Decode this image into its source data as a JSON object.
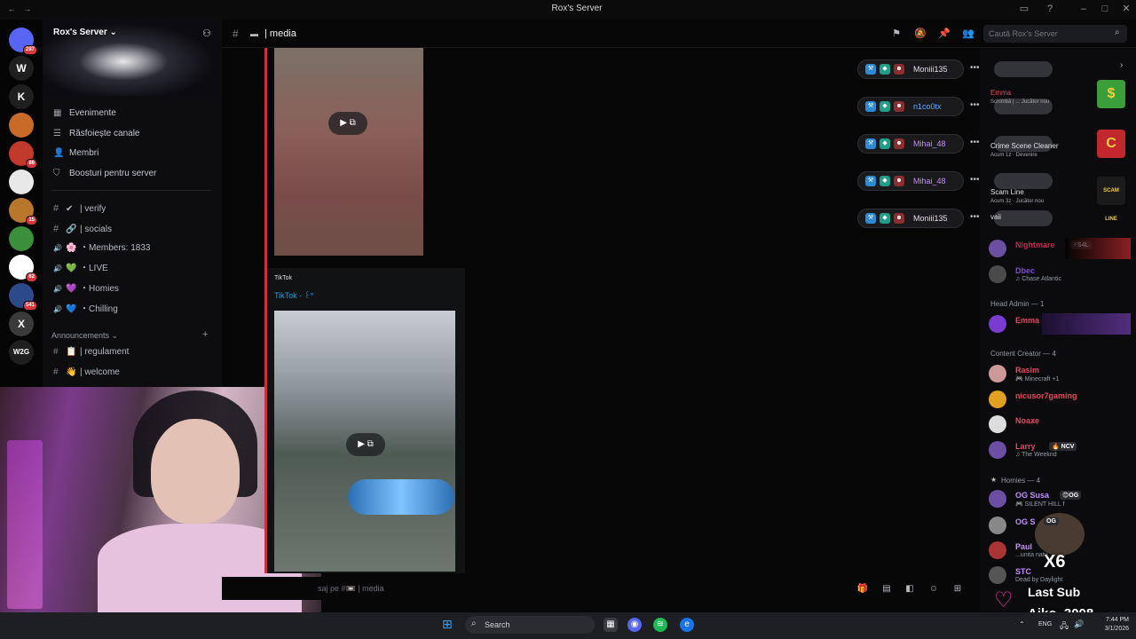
{
  "window": {
    "title": "Rox's Server"
  },
  "server": {
    "name": "Rox's Server",
    "nav": [
      {
        "label": "Evenimente",
        "icon": "calendar-icon"
      },
      {
        "label": "Răsfoiește canale",
        "icon": "browse-icon"
      },
      {
        "label": "Membri",
        "icon": "members-icon"
      },
      {
        "label": "Boosturi pentru server",
        "icon": "boost-icon"
      }
    ],
    "channels": [
      {
        "label": "| verify",
        "type": "text",
        "emoji": "✔"
      },
      {
        "label": "| socials",
        "type": "text",
        "emoji": "🔗"
      },
      {
        "label": "・Members: 1833",
        "type": "voice",
        "emoji": "🌸"
      },
      {
        "label": "・LIVE",
        "type": "voice",
        "emoji": "💚"
      },
      {
        "label": "・Homies",
        "type": "voice",
        "emoji": "💜"
      },
      {
        "label": "・Chilling",
        "type": "voice",
        "emoji": "💙"
      }
    ],
    "category": "Announcements",
    "announcement_channels": [
      {
        "label": "| regulament",
        "emoji": "📋"
      },
      {
        "label": "| welcome",
        "emoji": "👋"
      }
    ]
  },
  "server_rail": [
    {
      "letter": "",
      "badge": "287"
    },
    {
      "letter": "W",
      "badge": ""
    },
    {
      "letter": "K",
      "badge": ""
    },
    {
      "letter": "",
      "badge": ""
    },
    {
      "letter": "",
      "badge": "86"
    },
    {
      "letter": "",
      "badge": ""
    },
    {
      "letter": "",
      "badge": "15"
    },
    {
      "letter": "",
      "badge": ""
    },
    {
      "letter": "",
      "badge": "62"
    },
    {
      "letter": "",
      "badge": "541"
    },
    {
      "letter": "X",
      "badge": ""
    },
    {
      "letter": "W2G",
      "badge": ""
    }
  ],
  "header": {
    "channel": "| media",
    "search_placeholder": "Caută Rox's Server"
  },
  "embed": {
    "provider": "TikTok",
    "title": "TikTok · ꒰ᐢ"
  },
  "composer": {
    "placeholder": "saj pe #📼 | media"
  },
  "voice_overlay": [
    {
      "name": "Moniii135",
      "color": "#e7d9f0"
    },
    {
      "name": "n1co0tx",
      "color": "#5aa7ff"
    },
    {
      "name": "Mihai_48",
      "color": "#c58bff"
    },
    {
      "name": "Mihai_48",
      "color": "#c58bff"
    },
    {
      "name": "Moniii135",
      "color": "#e7d9f0"
    }
  ],
  "activity_overlay": [
    {
      "title": "Emma",
      "sub": "Schimbă | ... Jucător nou"
    },
    {
      "title": "Crime Scene Cleaner",
      "sub": "Acum 1z · Devenire"
    },
    {
      "title": "Scam Line",
      "sub": "Acum 3z · Jucător nou"
    },
    {
      "title": "vaii",
      "sub": ""
    }
  ],
  "members": {
    "top": [
      {
        "name": "Nightmare",
        "tag": "⚡S4L",
        "status": "",
        "color": "#c7264c"
      },
      {
        "name": "Dbec",
        "tag": "",
        "status": "♫ Chase Atlantic",
        "color": "#7b4bd8"
      }
    ],
    "head_admin_label": "Head Admin — 1",
    "head_admin": [
      {
        "name": "Emma",
        "color": "#e8455f"
      }
    ],
    "content_creator_label": "Content Creator — 4",
    "content_creator": [
      {
        "name": "Rasim",
        "status": "🎮 Minecraft +1",
        "color": "#e8455f"
      },
      {
        "name": "nicusor7gaming",
        "status": "",
        "color": "#e8455f"
      },
      {
        "name": "Noaxe",
        "status": "",
        "color": "#e8455f"
      },
      {
        "name": "Larry",
        "tag": "🔥 NCV",
        "status": "♫ The Weeknd",
        "color": "#e8455f"
      }
    ],
    "homies_label": "Homies — 4",
    "homies": [
      {
        "name": "OG Susa",
        "tag": "😊OG",
        "status": "🎮 SILENT HILL f",
        "color": "#c58bff"
      },
      {
        "name": "OG S",
        "tag": "OG",
        "status": "",
        "color": "#c58bff"
      },
      {
        "name": "Paul",
        "status": "...unita natu",
        "color": "#c58bff"
      },
      {
        "name": "STC",
        "status": "Dead by Daylight",
        "color": "#c58bff"
      }
    ]
  },
  "stream_overlay": {
    "x6": "X6",
    "last_sub_label": "Last Sub",
    "last_sub_name": "Aiko_3008"
  },
  "taskbar": {
    "search": "Search",
    "lang": "ENG",
    "time": "7:44 PM",
    "date": "3/1/2026"
  }
}
